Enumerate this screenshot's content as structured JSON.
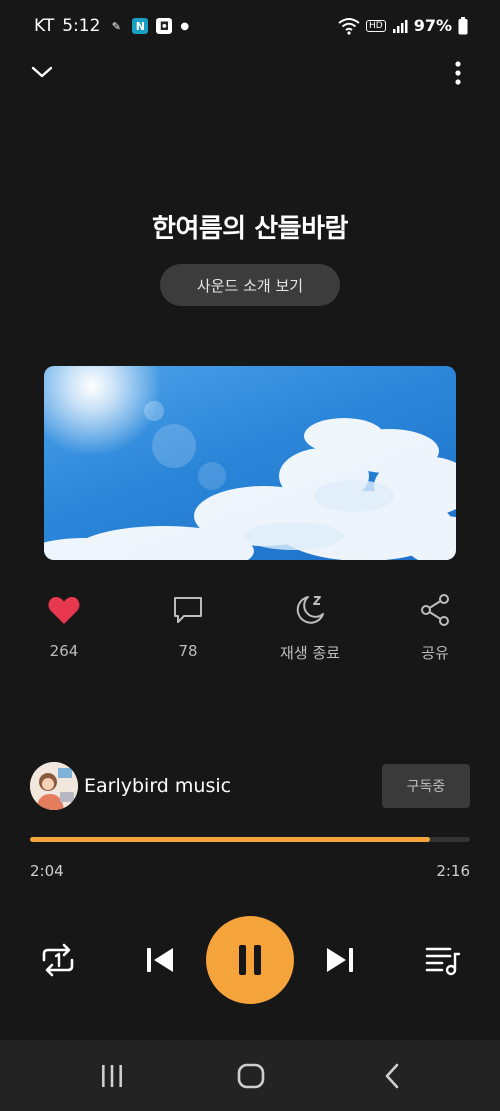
{
  "status_bar": {
    "carrier": "KT",
    "time": "5:12",
    "notif_icons": [
      "pen-icon",
      "naver-icon",
      "app-icon"
    ],
    "battery": "97%"
  },
  "player": {
    "title": "한여름의 산들바람",
    "intro_button": "사운드 소개 보기",
    "actions": [
      {
        "label": "264",
        "icon": "heart-icon"
      },
      {
        "label": "78",
        "icon": "comment-icon"
      },
      {
        "label": "재생 종료",
        "icon": "sleep-timer-icon"
      },
      {
        "label": "공유",
        "icon": "share-icon"
      }
    ],
    "channel": {
      "name": "Earlybird music",
      "subscribe_label": "구독중"
    },
    "progress": {
      "current": "2:04",
      "total": "2:16",
      "fraction": 0.91
    },
    "colors": {
      "accent": "#f5a33b",
      "like": "#e8384f",
      "background": "#171717"
    }
  }
}
